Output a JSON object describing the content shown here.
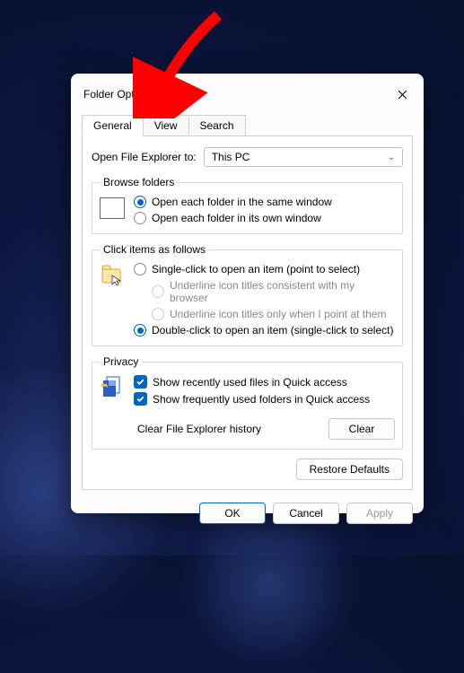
{
  "window": {
    "title": "Folder Options"
  },
  "tabs": [
    "General",
    "View",
    "Search"
  ],
  "open_to": {
    "label": "Open File Explorer to:",
    "value": "This PC"
  },
  "browse": {
    "legend": "Browse folders",
    "opt_same": "Open each folder in the same window",
    "opt_own": "Open each folder in its own window"
  },
  "click": {
    "legend": "Click items as follows",
    "opt_single": "Single-click to open an item (point to select)",
    "opt_browser": "Underline icon titles consistent with my browser",
    "opt_point": "Underline icon titles only when I point at them",
    "opt_double": "Double-click to open an item (single-click to select)"
  },
  "privacy": {
    "legend": "Privacy",
    "opt_files": "Show recently used files in Quick access",
    "opt_folders": "Show frequently used folders in Quick access",
    "clear_label": "Clear File Explorer history",
    "clear_btn": "Clear"
  },
  "restore_btn": "Restore Defaults",
  "footer": {
    "ok": "OK",
    "cancel": "Cancel",
    "apply": "Apply"
  }
}
